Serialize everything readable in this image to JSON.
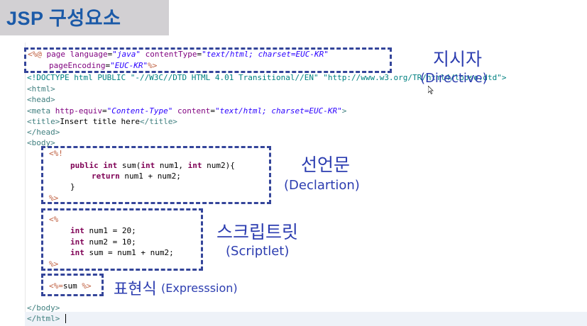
{
  "slide": {
    "title": "JSP 구성요소"
  },
  "editor": {
    "directive_line1": {
      "open": "<%@",
      "kw1": " page ",
      "attr1": "language",
      "eq1": "=",
      "val1": "\"java\"",
      "attr2": " contentType",
      "eq2": "=",
      "val2": "\"text/html; charset=EUC-KR\""
    },
    "directive_line2": {
      "attr": "pageEncoding",
      "eq": "=",
      "val": "\"EUC-KR\"",
      "close": "%>"
    },
    "doctype_line": "<!DOCTYPE html PUBLIC \"-//W3C//DTD HTML 4.01 Transitional//EN\" \"http://www.w3.org/TR/html4/loose.dtd\">",
    "html_open": "<html>",
    "head_open": "<head>",
    "meta_line": {
      "tag_open": "<meta",
      "attr1": " http-equiv",
      "eq1": "=",
      "val1": "\"Content-Type\"",
      "attr2": " content",
      "eq2": "=",
      "val2": "\"text/html; charset=EUC-KR\"",
      "tag_close": ">"
    },
    "title_line": {
      "open": "<title>",
      "text": "Insert title here",
      "close": "</title>"
    },
    "head_close": "</head>",
    "body_open": "<body>",
    "declaration": {
      "open": "<%!",
      "kw_public": "public",
      "kw_int": "int",
      "sig_rest1": " sum(",
      "kw_int2": "int",
      "sig_rest2": " num1, ",
      "kw_int3": "int",
      "sig_rest3": " num2){",
      "kw_return": "return",
      "return_rest": " num1 + num2;",
      "brace": "}",
      "close": "%>"
    },
    "scriptlet": {
      "open": "<%",
      "line1_kw": "int",
      "line1": " num1 = 20;",
      "line2_kw": "int",
      "line2": " num2 = 10;",
      "line3_kw": "int",
      "line3": " sum = num1 + num2;",
      "close": "%>"
    },
    "expression": {
      "open": "<%=",
      "body": "sum ",
      "close": "%>"
    },
    "body_close": "</body>",
    "html_close": "</html>"
  },
  "annotations": {
    "directive": {
      "ko": "지시자",
      "en": "(Directive)"
    },
    "declaration": {
      "ko": "선언문",
      "en": "(Declartion)"
    },
    "scriptlet": {
      "ko": "스크립트릿",
      "en": "(Scriptlet)"
    },
    "expression": {
      "ko": "표현식",
      "en": "(Expresssion)"
    }
  },
  "colors": {
    "title": "#1b5aa8",
    "annotation": "#2c3db0",
    "dashed_box": "#34459a",
    "keyword": "#7f0055",
    "jsp_delimiter": "#bf5f3f",
    "tag": "#3f7f7f",
    "attribute": "#7f007f",
    "value": "#2a00ff"
  },
  "icons": {
    "cursor": "mouse-pointer-icon"
  }
}
